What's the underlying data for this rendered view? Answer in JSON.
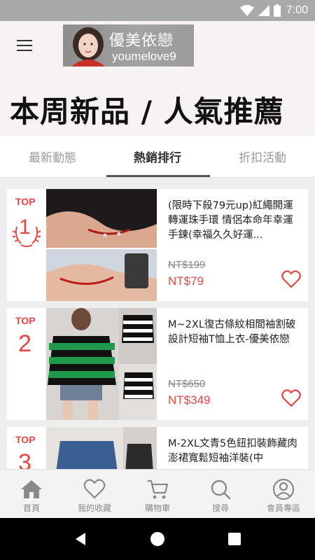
{
  "status_bar": {
    "time": "7:00"
  },
  "header": {
    "logo_title": "優美依戀",
    "logo_subtitle": "youmelove9",
    "page_title": "本周新品 / 人氣推薦"
  },
  "tabs": [
    {
      "label": "最新動態",
      "active": false
    },
    {
      "label": "熱銷排行",
      "active": true
    },
    {
      "label": "折扣活動",
      "active": false
    }
  ],
  "products": [
    {
      "rank_label": "TOP",
      "rank": "1",
      "name": "(限時下殺79元up)紅繩開運轉運珠手環 情侶本命年幸運手鍊(幸福久久好運...",
      "original_price": "NT$199",
      "price": "NT$79"
    },
    {
      "rank_label": "TOP",
      "rank": "2",
      "name": "M~2XL復古條紋相間袖割破設計短袖T恤上衣-優美依戀",
      "original_price": "NT$650",
      "price": "NT$349"
    },
    {
      "rank_label": "TOP",
      "rank": "3",
      "name": "M-2XL文青5色鈕扣裝飾藏肉澎裙寬鬆短袖洋裝(中",
      "original_price": "",
      "price": ""
    }
  ],
  "bottom_nav": [
    {
      "label": "首頁",
      "icon": "home-icon"
    },
    {
      "label": "我的收藏",
      "icon": "heart-icon"
    },
    {
      "label": "購物車",
      "icon": "cart-icon"
    },
    {
      "label": "搜尋",
      "icon": "search-icon"
    },
    {
      "label": "會員專區",
      "icon": "user-icon"
    }
  ],
  "colors": {
    "accent": "#e84545",
    "header_bg": "#f7f3f2",
    "status_bar_bg": "#a9a9a9"
  }
}
